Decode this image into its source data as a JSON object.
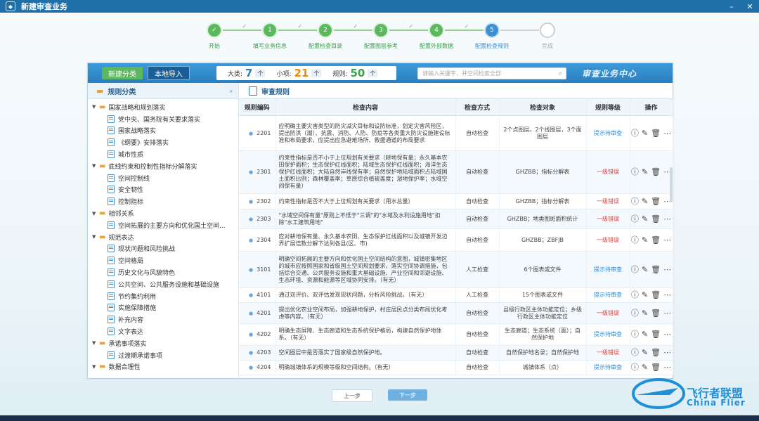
{
  "window": {
    "title": "新建审查业务"
  },
  "steps": [
    {
      "label": "开始",
      "num": "✓",
      "state": "done"
    },
    {
      "label": "填写业务信息",
      "num": "1",
      "state": "done"
    },
    {
      "label": "配置检查目录",
      "num": "2",
      "state": "done"
    },
    {
      "label": "配置图层参考",
      "num": "3",
      "state": "done"
    },
    {
      "label": "配置外部数据",
      "num": "4",
      "state": "done"
    },
    {
      "label": "配置检查规则",
      "num": "5",
      "state": "current"
    },
    {
      "label": "完成",
      "num": "",
      "state": "todo"
    }
  ],
  "toolbar": {
    "new_category": "新建分类",
    "local_import": "本地导入",
    "major_label": "大类:",
    "major_count": "7",
    "major_unit": "个",
    "minor_label": "小项:",
    "minor_count": "21",
    "minor_unit": "个",
    "rule_label": "规则:",
    "rule_count": "50",
    "rule_unit": "个",
    "search_placeholder": "请输入关键字，并空间检索全部",
    "brand": "审查业务中心"
  },
  "left": {
    "header": "规则分类",
    "tree": [
      {
        "label": "国家战略和规划落实",
        "level": 0
      },
      {
        "label": "党中央、国务院有关要求落实",
        "level": 1
      },
      {
        "label": "国家战略落实",
        "level": 1
      },
      {
        "label": "《纲要》安排落实",
        "level": 1
      },
      {
        "label": "城市性质",
        "level": 1
      },
      {
        "label": "底线约束和控制性指标分解落实",
        "level": 0
      },
      {
        "label": "空间控制线",
        "level": 1
      },
      {
        "label": "安全韧性",
        "level": 1
      },
      {
        "label": "控制指标",
        "level": 1
      },
      {
        "label": "相邻关系",
        "level": 0
      },
      {
        "label": "空间拓展的主要方向和优化国土空间...",
        "level": 1
      },
      {
        "label": "规范表达",
        "level": 0
      },
      {
        "label": "现状问题和风险挑战",
        "level": 1
      },
      {
        "label": "空间格局",
        "level": 1
      },
      {
        "label": "历史文化与风貌特色",
        "level": 1
      },
      {
        "label": "公共空间、公共服务设施和基础设施",
        "level": 1
      },
      {
        "label": "节约集约利用",
        "level": 1
      },
      {
        "label": "实施保障措施",
        "level": 1
      },
      {
        "label": "补充内容",
        "level": 1
      },
      {
        "label": "文字表达",
        "level": 1
      },
      {
        "label": "承诺事项落实",
        "level": 0
      },
      {
        "label": "过渡期承诺事项",
        "level": 1
      },
      {
        "label": "数据合理性",
        "level": 0
      }
    ]
  },
  "right": {
    "header": "审查规则",
    "columns": [
      "规则编码",
      "检查内容",
      "检查方式",
      "检查对象",
      "规则等级",
      "操作"
    ],
    "rows": [
      {
        "code": "2201",
        "content": "应明确主要灾害类型的防灾减灾目标和设防标准，划定灾害风险区，提出防洪（潮）、抗震、消防、人防、防疫等各类重大防灾设施建设标准和布局要求，应提出应急避难场所、救援通道的布局要求",
        "method": "自动检查",
        "object": "2个点图层，2个线图层，3个面图层",
        "level": "提示待审查",
        "levelType": "blue",
        "h": 50
      },
      {
        "code": "2301",
        "content": "约束性指标是否不小于上位规划有关要求（耕地保有量；永久基本农田保护面积；生态保护红线面积；陆域生态保护红线面积；海洋生态保护红线面积；大陆自然岸线保有率；自然保护地陆域面积占陆域国土面积比例；森林覆盖率；草原综合植被盖度；湿地保护率；水域空间保有量）",
        "method": "自动检查",
        "object": "GHZBB；指标分解表",
        "level": "一级错误",
        "levelType": "red",
        "h": 61
      },
      {
        "code": "2302",
        "content": "约束性指标是否不大于上位规划有关要求（用水总量）",
        "method": "自动检查",
        "object": "GHZBB；指标分解表",
        "level": "一级错误",
        "levelType": "red",
        "h": 22
      },
      {
        "code": "2303",
        "content": "\"水域空间保有量\"原则上不低于\"三调\"的\"水域及水利设施用地\"扣除\"水工建筑用地\"",
        "method": "自动检查",
        "object": "GHZBB；地类图斑面积统计",
        "level": "一级错误",
        "levelType": "red",
        "h": 28
      },
      {
        "code": "2304",
        "content": "应对耕地保有量、永久基本农田、生态保护红线面积以及城镇开发边界扩展倍数分解下达到各县(区、市)",
        "method": "自动检查",
        "object": "GHZBB；ZBFJB",
        "level": "一级错误",
        "levelType": "red",
        "h": 32
      },
      {
        "code": "3101",
        "content": "明确空间拓展的主要方向和优化国土空间结构的意图，城镇密集地区的城市应按照国家和省级国土空间规划要求，落实空间协调措施，包括综合交通、公共服务设施和重大基础设施、产业空间和邻避设施、生态环境、资源和能源等区域协同安排。（有无）",
        "method": "人工检查",
        "object": "6个图表或文件",
        "level": "提示待审查",
        "levelType": "blue",
        "h": 52
      },
      {
        "code": "4101",
        "content": "通过双评价、双评估发现现状问题，分析风险挑战。（有无）",
        "method": "人工检查",
        "object": "15个图表或文件",
        "level": "提示待审查",
        "levelType": "blue",
        "h": 21
      },
      {
        "code": "4201",
        "content": "提出优化农业空间布局，加强耕地保护，村庄居民点分类布局优化考虑等内容。（有无）",
        "method": "自动检查",
        "object": "县级行政区主体功能定位；乡级行政区主体功能定位",
        "level": "一级错误",
        "levelType": "red",
        "h": 30
      },
      {
        "code": "4202",
        "content": "明确生态屏障、生态廊道和生态系统保护格局，构建自然保护地体系。（有无）",
        "method": "自动检查",
        "object": "生态廊道；生态系统（面）；自然保护地",
        "level": "提示待审查",
        "levelType": "blue",
        "h": 31
      },
      {
        "code": "4203",
        "content": "空间图层中是否落实了国家级自然保护地。",
        "method": "自动检查",
        "object": "自然保护地名录；自然保护地",
        "level": "一级错误",
        "levelType": "red",
        "h": 21
      },
      {
        "code": "4204",
        "content": "明确城镇体系的规模等级和空间结构。（有无）",
        "method": "自动检查",
        "object": "城镇体系（点）",
        "level": "提示待审查",
        "levelType": "blue",
        "h": 21
      }
    ]
  },
  "footer": {
    "prev": "上一步",
    "next": "下一步"
  },
  "watermark": {
    "cn": "飞行者联盟",
    "en": "China Flier"
  }
}
